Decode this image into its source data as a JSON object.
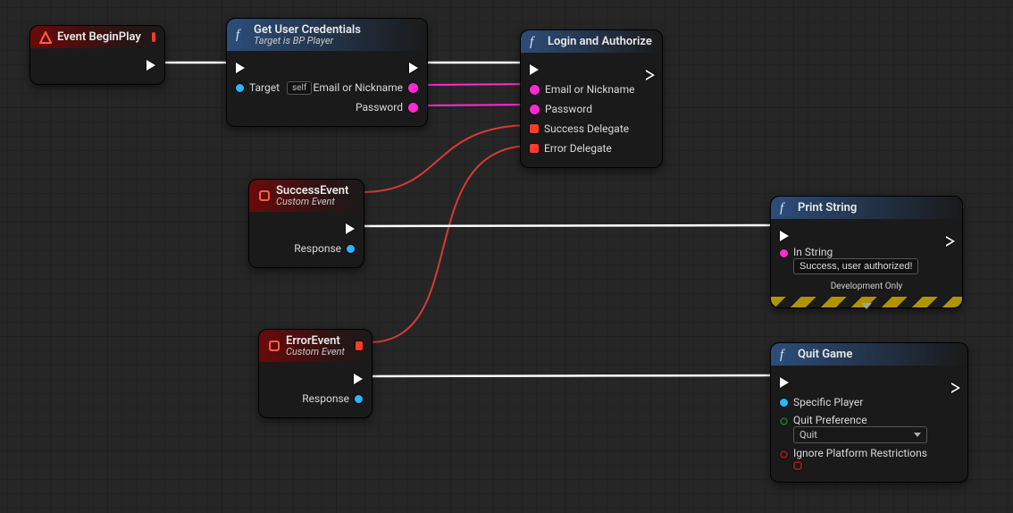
{
  "nodes": {
    "beginplay": {
      "title": "Event BeginPlay"
    },
    "getcreds": {
      "title": "Get User Credentials",
      "subtitle": "Target is BP Player",
      "target_label": "Target",
      "target_value": "self",
      "out_email": "Email or Nickname",
      "out_password": "Password"
    },
    "login": {
      "title": "Login and Authorize",
      "in_email": "Email or Nickname",
      "in_password": "Password",
      "in_success": "Success Delegate",
      "in_error": "Error Delegate"
    },
    "successEvt": {
      "title": "SuccessEvent",
      "subtitle": "Custom Event",
      "out_response": "Response"
    },
    "errorEvt": {
      "title": "ErrorEvent",
      "subtitle": "Custom Event",
      "out_response": "Response"
    },
    "printStr": {
      "title": "Print String",
      "in_string_label": "In String",
      "in_string_value": "Success, user authorized!",
      "dev_label": "Development Only"
    },
    "quit": {
      "title": "Quit Game",
      "in_player": "Specific Player",
      "in_pref_label": "Quit Preference",
      "in_pref_value": "Quit",
      "in_ignore": "Ignore Platform Restrictions"
    }
  }
}
